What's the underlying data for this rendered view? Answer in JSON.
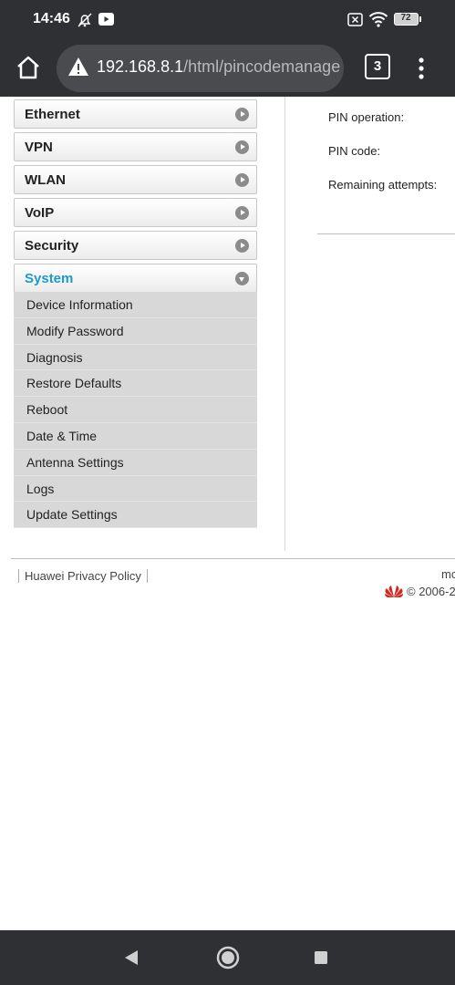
{
  "status": {
    "time": "14:46",
    "battery": "72"
  },
  "browser": {
    "url_host": "192.168.8.1",
    "url_path": "/html/pincodemanage",
    "tab_count": "3"
  },
  "sidebar": {
    "items": [
      {
        "label": "Ethernet"
      },
      {
        "label": "VPN"
      },
      {
        "label": "WLAN"
      },
      {
        "label": "VoIP"
      },
      {
        "label": "Security"
      },
      {
        "label": "System"
      }
    ],
    "system_submenu": [
      "Device Information",
      "Modify Password",
      "Diagnosis",
      "Restore Defaults",
      "Reboot",
      "Date & Time",
      "Antenna Settings",
      "Logs",
      "Update Settings"
    ]
  },
  "main": {
    "pin_operation_label": "PIN operation:",
    "pin_code_label": "PIN code:",
    "remaining_attempts_label": "Remaining attempts:"
  },
  "footer": {
    "privacy_label": "Huawei Privacy Policy",
    "partial_text": "mo",
    "copyright": "© 2006-2"
  },
  "colors": {
    "active_menu": "#1e9ac9",
    "browser_chrome": "#2f3033",
    "submenu_bg": "#d8d8d8"
  }
}
